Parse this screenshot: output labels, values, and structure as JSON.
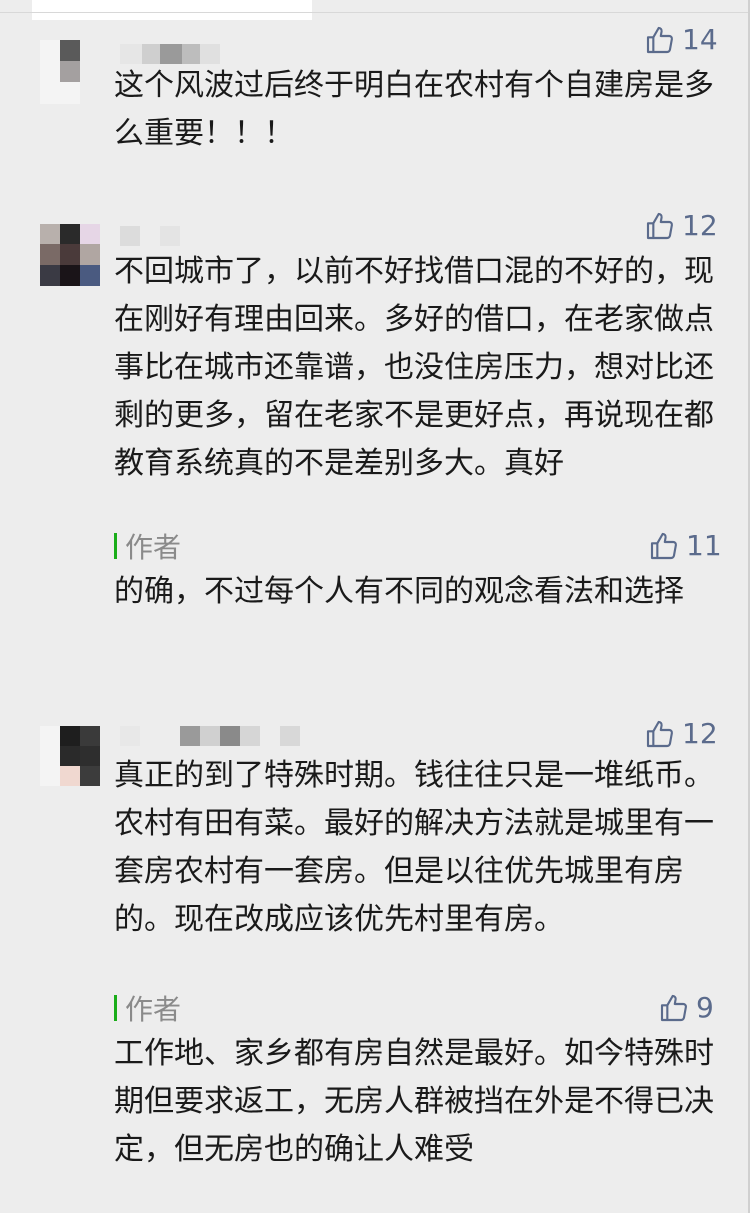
{
  "comments": [
    {
      "likes": "14",
      "text": "这个风波过后终于明白在农村有个自建房是多么重要！！！"
    },
    {
      "likes": "12",
      "text": "不回城市了，以前不好找借口混的不好的，现在刚好有理由回来。多好的借口，在老家做点事比在城市还靠谱，也没住房压力，想对比还剩的更多，留在老家不是更好点，再说现在都教育系统真的不是差别多大。真好",
      "reply": {
        "author_label": "作者",
        "likes": "11",
        "text": "的确，不过每个人有不同的观念看法和选择"
      }
    },
    {
      "likes": "12",
      "text": "真正的到了特殊时期。钱往往只是一堆纸币。农村有田有菜。最好的解决方法就是城里有一套房农村有一套房。但是以往优先城里有房的。现在改成应该优先村里有房。",
      "reply": {
        "author_label": "作者",
        "likes": "9",
        "text": "工作地、家乡都有房自然是最好。如今特殊时期但要求返工，无房人群被挡在外是不得已决定，但无房也的确让人难受"
      }
    }
  ],
  "colors": {
    "like": "#5b6b8c",
    "author_bar": "#1aad19",
    "text": "#1a1a1a",
    "background": "#ededed"
  },
  "icons": {
    "like": "thumbs-up-icon"
  }
}
